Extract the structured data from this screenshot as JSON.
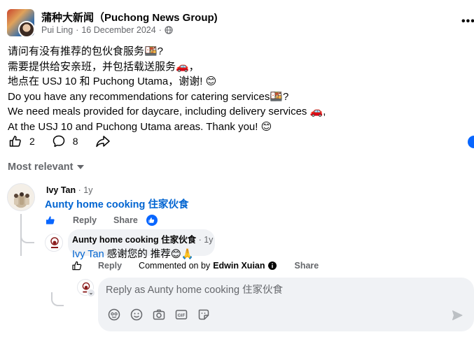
{
  "post": {
    "group_name": "蒲种大新闻（Puchong News Group)",
    "author": "Pui Ling",
    "separator": "·",
    "date": "16 December 2024",
    "more_label": "•••",
    "lines": [
      "请问有没有推荐的包伙食服务🍱?",
      "需要提供给安亲班，并包括载送服务🚗，",
      "地点在 USJ 10 和 Puchong Utama，谢谢! 😊",
      "Do you have any recommendations for catering services🍱?",
      "We need meals provided for daycare, including delivery services 🚗,",
      "At the USJ 10 and Puchong Utama areas. Thank you! 😊"
    ],
    "like_count": "2",
    "comment_count": "8"
  },
  "comments": {
    "sort_label": "Most relevant",
    "first": {
      "name": "Ivy Tan",
      "time": "· 1y",
      "text": "Aunty home cooking 住家伙食",
      "reply_label": "Reply",
      "share_label": "Share"
    },
    "reply": {
      "name": "Aunty home cooking 住家伙食",
      "time": "· 1y",
      "mention": "Ivy Tan",
      "text": " 感谢您的 推荐😊🙏",
      "reply_label": "Reply",
      "commented_on_by": "Commented on by",
      "commented_by_name": "Edwin Xuian",
      "share_label": "Share"
    }
  },
  "composer": {
    "placeholder": "Reply as Aunty home cooking 住家伙食"
  },
  "colors": {
    "accent": "#0866ff",
    "link": "#0064d1",
    "muted": "#65676b",
    "bubble": "#f0f2f5"
  },
  "icons": [
    "globe-icon",
    "like-icon",
    "comment-icon",
    "share-icon",
    "chevron-down-icon",
    "info-icon",
    "emoji-icon",
    "camera-icon",
    "gif-icon",
    "sticker-icon",
    "avatar-sticker-icon",
    "send-icon"
  ]
}
